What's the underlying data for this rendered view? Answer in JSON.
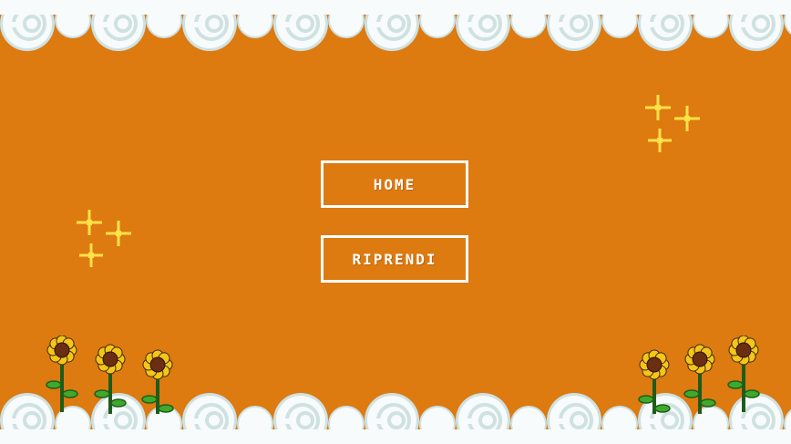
{
  "menu": {
    "home_label": "HOME",
    "resume_label": "RIPRENDI"
  },
  "colors": {
    "background": "#DD7A10",
    "button_border": "#FFFFFF",
    "button_text": "#FFFFFF",
    "cloud_fill": "#F7FBFB",
    "cloud_shade": "#CFE1E1",
    "sparkle": "#FFE24A",
    "flower_petal": "#F5C518",
    "flower_center": "#6B2E12",
    "stem": "#1F5C1A",
    "leaf": "#3EAA2C"
  },
  "icons": {
    "clouds": "pixel-cloud-icon",
    "sparkle": "sparkle-icon",
    "flower": "sunflower-icon"
  }
}
